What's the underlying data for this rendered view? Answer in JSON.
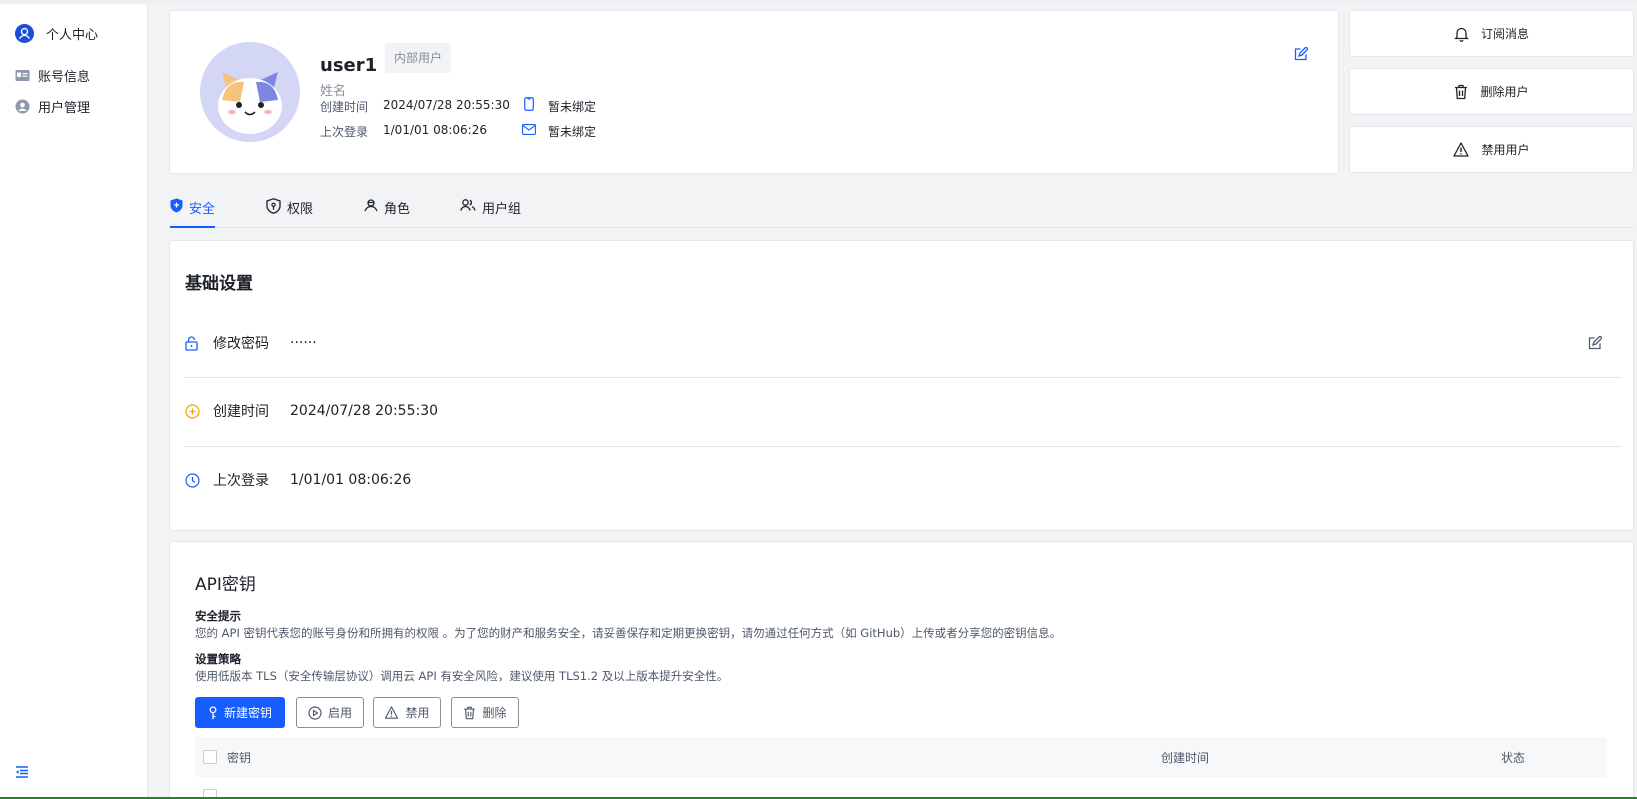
{
  "sidebar": {
    "header": "个人中心",
    "items": [
      {
        "label": "账号信息",
        "icon": "id-card-icon"
      },
      {
        "label": "用户管理",
        "icon": "user-manage-icon"
      }
    ],
    "collapse_icon": "menu-fold-icon"
  },
  "profile": {
    "username": "user1",
    "tag": "内部用户",
    "display_name": "姓名",
    "created_label": "创建时间",
    "created_value": "2024/07/28 20:55:30",
    "last_login_label": "上次登录",
    "last_login_value": "1/01/01 08:06:26",
    "phone_status": "暂未绑定",
    "email_status": "暂未绑定"
  },
  "actions": {
    "subscribe": "订阅消息",
    "delete_user": "删除用户",
    "disable_user": "禁用用户"
  },
  "tabs": [
    {
      "label": "安全",
      "icon": "shield-icon",
      "active": true
    },
    {
      "label": "权限",
      "icon": "permission-icon",
      "active": false
    },
    {
      "label": "角色",
      "icon": "role-icon",
      "active": false
    },
    {
      "label": "用户组",
      "icon": "user-group-icon",
      "active": false
    }
  ],
  "basic": {
    "title": "基础设置",
    "rows": [
      {
        "label": "修改密码",
        "value": "······",
        "icon": "lock-icon",
        "editable": true
      },
      {
        "label": "创建时间",
        "value": "2024/07/28 20:55:30",
        "icon": "plus-circle-icon"
      },
      {
        "label": "上次登录",
        "value": "1/01/01 08:06:26",
        "icon": "clock-icon"
      }
    ]
  },
  "api": {
    "title": "API密钥",
    "security_tip_title": "安全提示",
    "security_tip_text": "您的 API 密钥代表您的账号身份和所拥有的权限 。为了您的财产和服务安全，请妥善保存和定期更换密钥，请勿通过任何方式（如 GitHub）上传或者分享您的密钥信息。",
    "policy_title": "设置策略",
    "policy_text": "使用低版本 TLS（安全传输层协议）调用云 API 有安全风险，建议使用 TLS1.2 及以上版本提升安全性。",
    "buttons": {
      "new_key": "新建密钥",
      "enable": "启用",
      "disable": "禁用",
      "delete": "删除"
    },
    "table_headers": {
      "key": "密钥",
      "created": "创建时间",
      "status": "状态"
    }
  },
  "colors": {
    "accent": "#165dff",
    "border": "#e5e6eb",
    "muted_text": "#86909c"
  }
}
